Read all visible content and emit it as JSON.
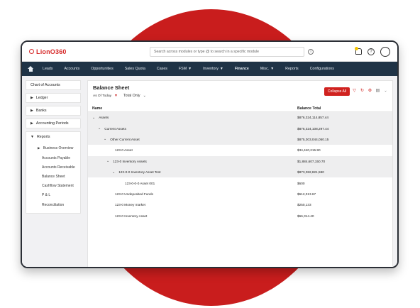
{
  "app": {
    "logo": "LionO360"
  },
  "search": {
    "placeholder": "Search across modules or type @ to search in a specific module"
  },
  "nav": {
    "items": [
      {
        "label": "Leads"
      },
      {
        "label": "Accounts"
      },
      {
        "label": "Opportunities"
      },
      {
        "label": "Sales Quota"
      },
      {
        "label": "Cases"
      },
      {
        "label": "FSM"
      },
      {
        "label": "Inventory"
      },
      {
        "label": "Finance"
      },
      {
        "label": "Misc."
      },
      {
        "label": "Reports"
      },
      {
        "label": "Configurations"
      }
    ]
  },
  "sidebar": {
    "items": [
      {
        "label": "Chart of Accounts"
      },
      {
        "label": "Ledger"
      },
      {
        "label": "Banks"
      },
      {
        "label": "Accounting Periods"
      }
    ],
    "reports": {
      "label": "Reports",
      "sub": "Business Overview",
      "children": [
        "Accounts Payable",
        "Accounts Receivable",
        "Balance Sheet",
        "Cashflow Statement",
        "P & L",
        "Reconciliation"
      ]
    }
  },
  "main": {
    "title": "Balance Sheet",
    "filter_asof": "As Of Today",
    "filter_total": "Total Only",
    "collapse_label": "Collapse All",
    "col_name": "Name",
    "col_balance": "Balance Total",
    "rows": [
      {
        "name": "Assets",
        "value": "$876,324,114,857.44"
      },
      {
        "name": "Current Assets",
        "value": "$876,324,108,297.44"
      },
      {
        "name": "Other Current Asset",
        "value": "$875,303,044,050.15"
      },
      {
        "name": "123-0 Asset",
        "value": "$34,440,215.90"
      },
      {
        "name": "123-0 Inventory Assets",
        "value": "$1,884,607,150.70"
      },
      {
        "name": "123-0-0 Inventory Asset Test",
        "value": "$873,382,821,590"
      },
      {
        "name": "123-0-0-0 Asset 001",
        "value": "$600"
      },
      {
        "name": "123-0 Undeposited Funds",
        "value": "$612,013.67"
      },
      {
        "name": "123-0 Money market",
        "value": "$250,133"
      },
      {
        "name": "123-0 Inventory Asset",
        "value": "$66,314.40"
      }
    ]
  },
  "colors": {
    "brand_red": "#c91d1d",
    "nav_bg": "#1f3346"
  }
}
